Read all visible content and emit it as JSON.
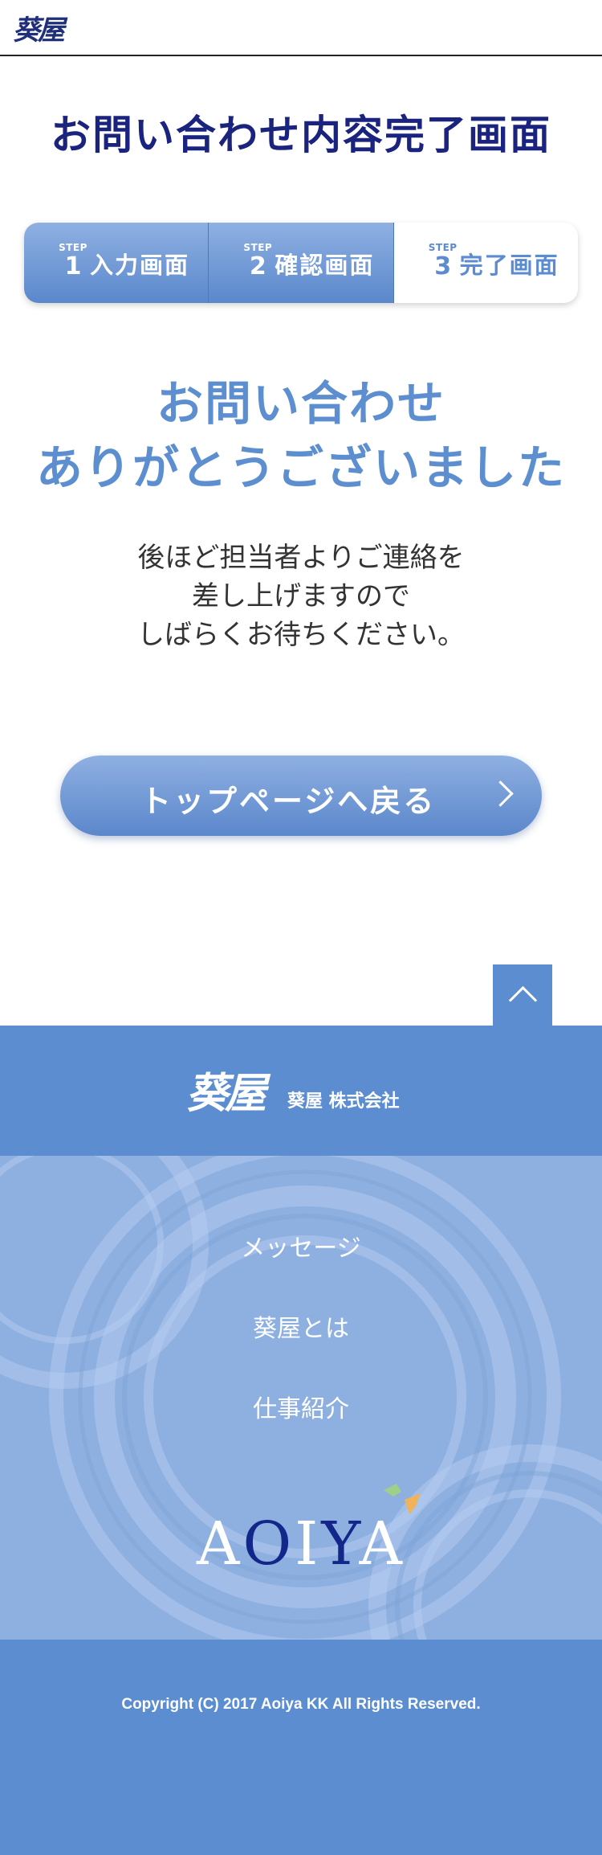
{
  "header": {
    "logo_text": "葵屋"
  },
  "page_title": "お問い合わせ内容完了画面",
  "steps": [
    {
      "tag": "STEP",
      "num": "1",
      "label": "入力画面"
    },
    {
      "tag": "STEP",
      "num": "2",
      "label": "確認画面"
    },
    {
      "tag": "STEP",
      "num": "3",
      "label": "完了画面"
    }
  ],
  "thanks": {
    "line1": "お問い合わせ",
    "line2": "ありがとうございました"
  },
  "note": {
    "line1": "後ほど担当者よりご連絡を",
    "line2": "差し上げますので",
    "line3": "しばらくお待ちください。"
  },
  "back_button": "トップページへ戻る",
  "footer": {
    "logo_text": "葵屋",
    "company": "葵屋 株式会社",
    "nav": [
      "メッセージ",
      "葵屋とは",
      "仕事紹介"
    ],
    "brand": {
      "a": "A",
      "o": "O",
      "i": "I",
      "y": "Y",
      "a2": "A"
    },
    "copyright": "Copyright (C) 2017 Aoiya KK All Rights Reserved."
  },
  "colors": {
    "accent": "#5b8dd0",
    "title": "#1a237e"
  }
}
